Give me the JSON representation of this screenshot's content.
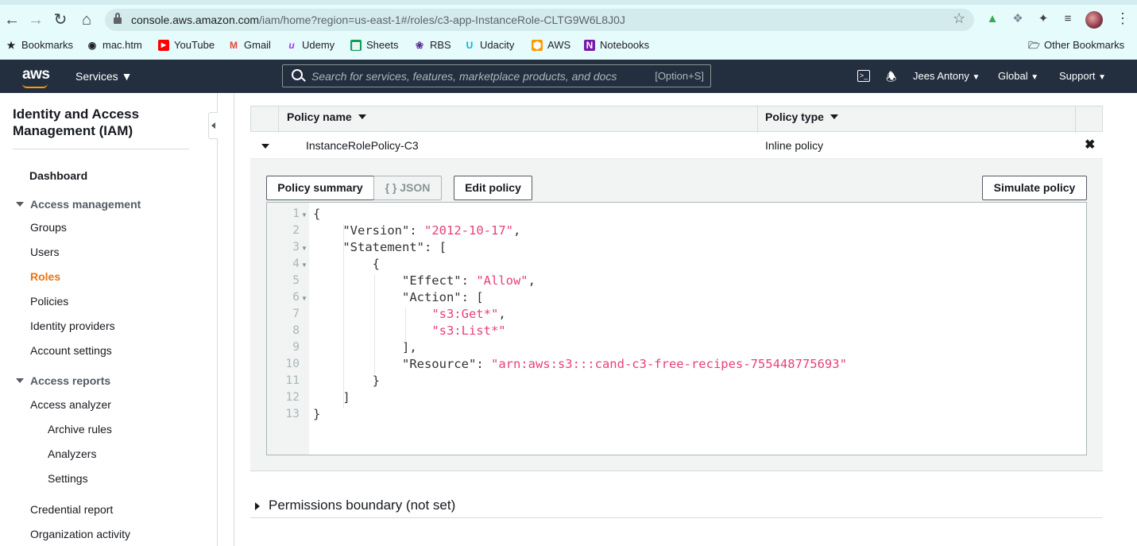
{
  "browser": {
    "url_host": "console.aws.amazon.com",
    "url_path": "/iam/home?region=us-east-1#/roles/c3-app-InstanceRole-CLTG9W6L8J0J",
    "bookmarks": [
      {
        "label": "Bookmarks",
        "icon": "star-icon"
      },
      {
        "label": "mac.htm",
        "icon": "globe-icon"
      },
      {
        "label": "YouTube",
        "icon": "youtube-icon"
      },
      {
        "label": "Gmail",
        "icon": "gmail-icon"
      },
      {
        "label": "Udemy",
        "icon": "udemy-icon"
      },
      {
        "label": "Sheets",
        "icon": "sheets-icon"
      },
      {
        "label": "RBS",
        "icon": "rbs-icon"
      },
      {
        "label": "Udacity",
        "icon": "udacity-icon"
      },
      {
        "label": "AWS",
        "icon": "aws-icon"
      },
      {
        "label": "Notebooks",
        "icon": "onenote-icon"
      }
    ],
    "other_bookmarks": "Other Bookmarks"
  },
  "header": {
    "logo": "aws",
    "services": "Services",
    "search_placeholder": "Search for services, features, marketplace products, and docs",
    "search_shortcut": "[Option+S]",
    "user": "Jees Antony",
    "region": "Global",
    "support": "Support"
  },
  "sidebar": {
    "title": "Identity and Access Management (IAM)",
    "dashboard": "Dashboard",
    "access_management": "Access management",
    "am_items": [
      "Groups",
      "Users",
      "Roles",
      "Policies",
      "Identity providers",
      "Account settings"
    ],
    "access_reports": "Access reports",
    "access_analyzer": "Access analyzer",
    "analyzer_items": [
      "Archive rules",
      "Analyzers",
      "Settings"
    ],
    "credential_report": "Credential report",
    "organization_activity": "Organization activity"
  },
  "policies_table": {
    "col_policy_name": "Policy name",
    "col_policy_type": "Policy type",
    "row": {
      "name": "InstanceRolePolicy-C3",
      "type": "Inline policy"
    }
  },
  "policy_detail": {
    "btn_summary": "Policy summary",
    "btn_json": "{ } JSON",
    "btn_edit": "Edit policy",
    "btn_simulate": "Simulate policy",
    "code": {
      "version_key": "\"Version\"",
      "version_val": "\"2012-10-17\"",
      "statement_key": "\"Statement\"",
      "effect_key": "\"Effect\"",
      "effect_val": "\"Allow\"",
      "action_key": "\"Action\"",
      "action_1": "\"s3:Get*\"",
      "action_2": "\"s3:List*\"",
      "resource_key": "\"Resource\"",
      "resource_val": "\"arn:aws:s3:::cand-c3-free-recipes-755448775693\""
    },
    "line_numbers": [
      "1",
      "2",
      "3",
      "4",
      "5",
      "6",
      "7",
      "8",
      "9",
      "10",
      "11",
      "12",
      "13"
    ]
  },
  "permissions_boundary": "Permissions boundary (not set)"
}
